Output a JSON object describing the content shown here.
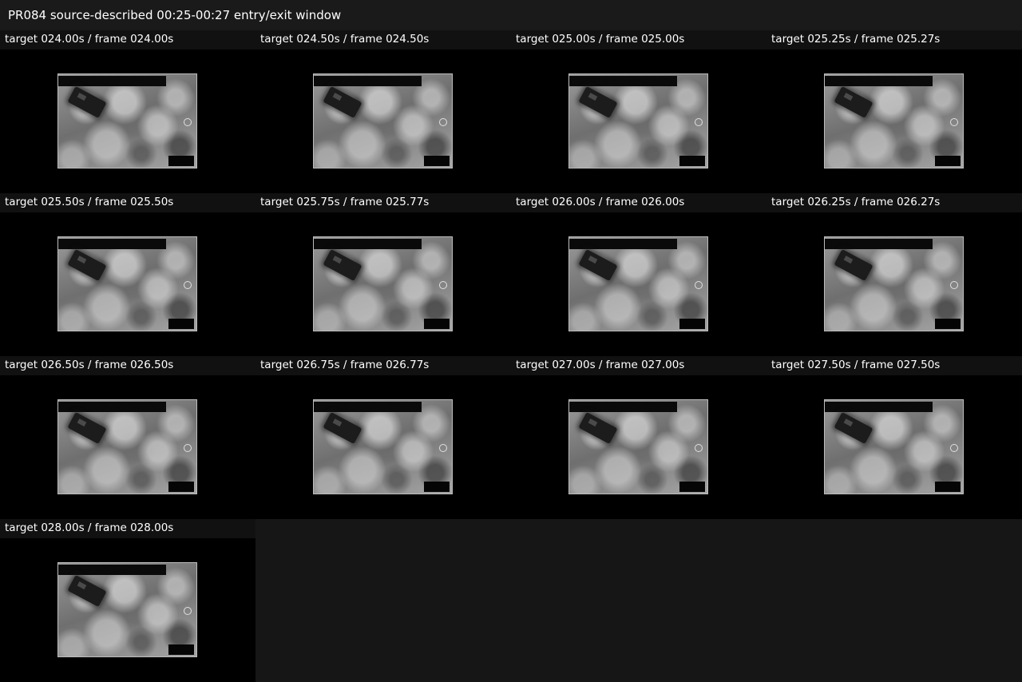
{
  "window": {
    "title": "PR084 source-described 00:25-00:27 entry/exit window"
  },
  "frames": [
    {
      "label": "target 024.00s / frame 024.00s"
    },
    {
      "label": "target 024.50s / frame 024.50s"
    },
    {
      "label": "target 025.00s / frame 025.00s"
    },
    {
      "label": "target 025.25s / frame 025.27s"
    },
    {
      "label": "target 025.50s / frame 025.50s"
    },
    {
      "label": "target 025.75s / frame 025.77s"
    },
    {
      "label": "target 026.00s / frame 026.00s"
    },
    {
      "label": "target 026.25s / frame 026.27s"
    },
    {
      "label": "target 026.50s / frame 026.50s"
    },
    {
      "label": "target 026.75s / frame 026.77s"
    },
    {
      "label": "target 027.00s / frame 027.00s"
    },
    {
      "label": "target 027.50s / frame 027.50s"
    },
    {
      "label": "target 028.00s / frame 028.00s"
    }
  ]
}
